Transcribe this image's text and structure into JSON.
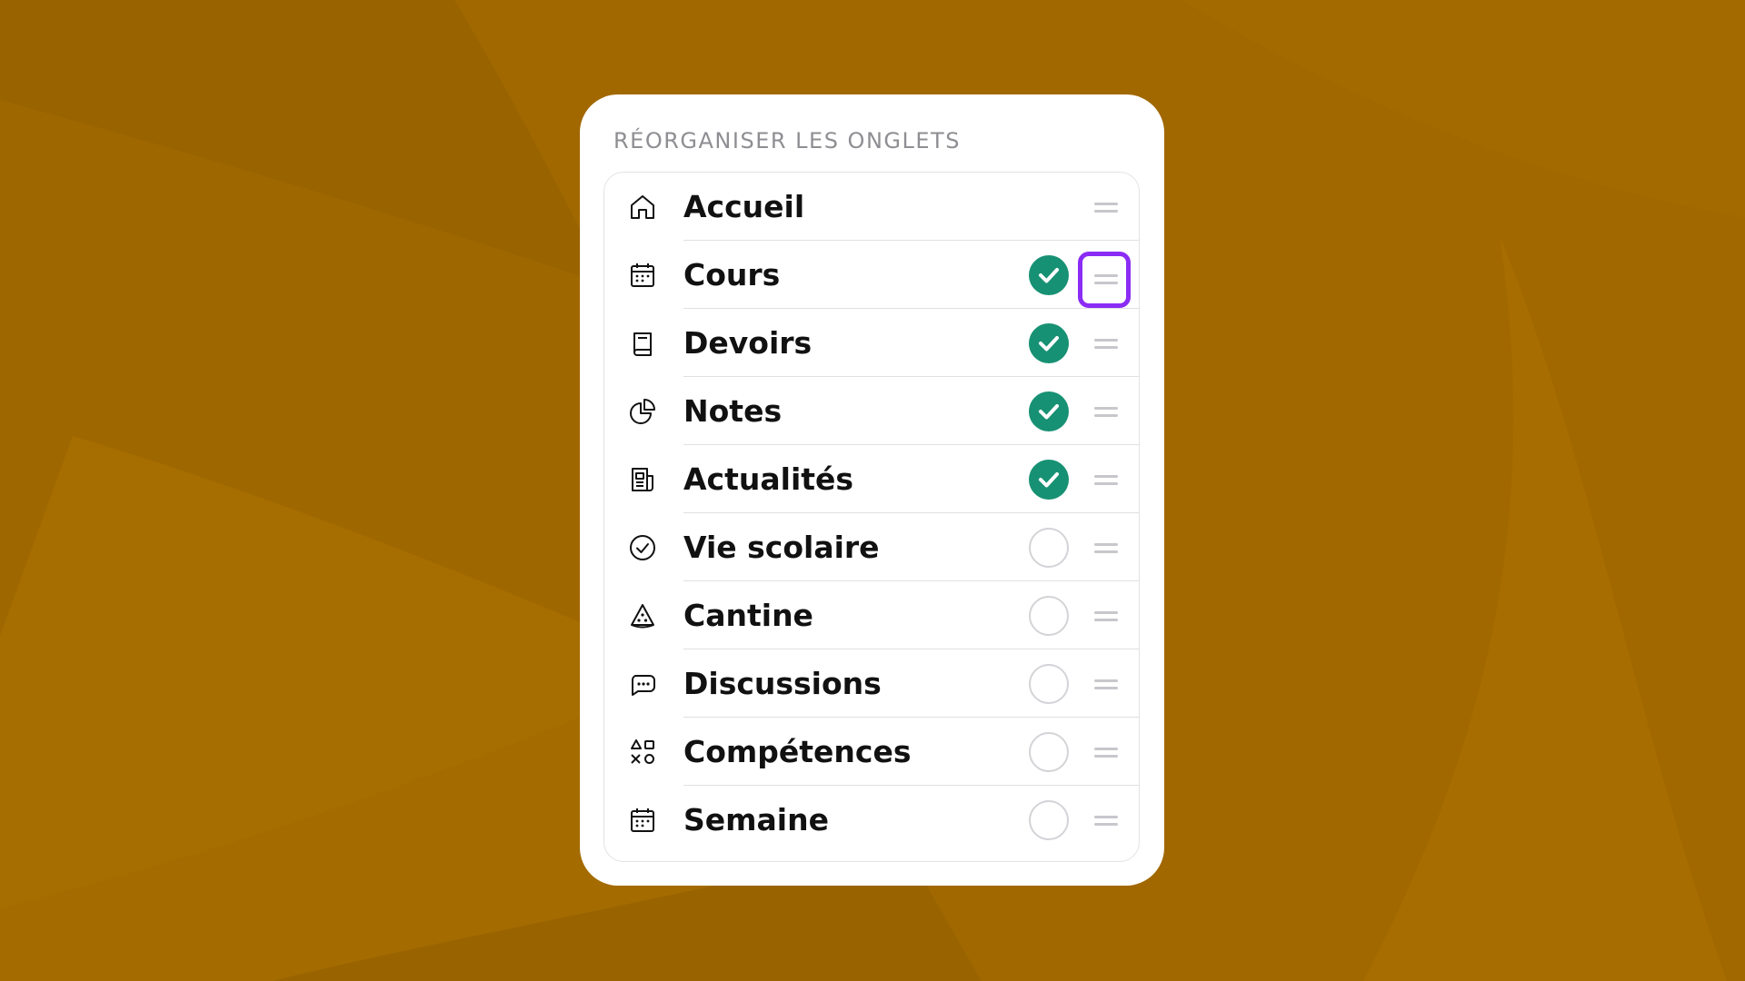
{
  "colors": {
    "background": "#996300",
    "accent_check": "#179173",
    "highlight": "#8b2cf5"
  },
  "panel": {
    "title": "RÉORGANISER LES ONGLETS"
  },
  "tabs": [
    {
      "label": "Accueil",
      "icon": "home-icon",
      "enabled": null
    },
    {
      "label": "Cours",
      "icon": "calendar-icon",
      "enabled": true
    },
    {
      "label": "Devoirs",
      "icon": "book-icon",
      "enabled": true
    },
    {
      "label": "Notes",
      "icon": "pie-chart-icon",
      "enabled": true
    },
    {
      "label": "Actualités",
      "icon": "newspaper-icon",
      "enabled": true
    },
    {
      "label": "Vie scolaire",
      "icon": "check-circle-icon",
      "enabled": false
    },
    {
      "label": "Cantine",
      "icon": "pizza-icon",
      "enabled": false
    },
    {
      "label": "Discussions",
      "icon": "chat-bubble-icon",
      "enabled": false
    },
    {
      "label": "Compétences",
      "icon": "shapes-icon",
      "enabled": false
    },
    {
      "label": "Semaine",
      "icon": "calendar-icon",
      "enabled": false
    }
  ],
  "highlighted_handle_index": 1
}
